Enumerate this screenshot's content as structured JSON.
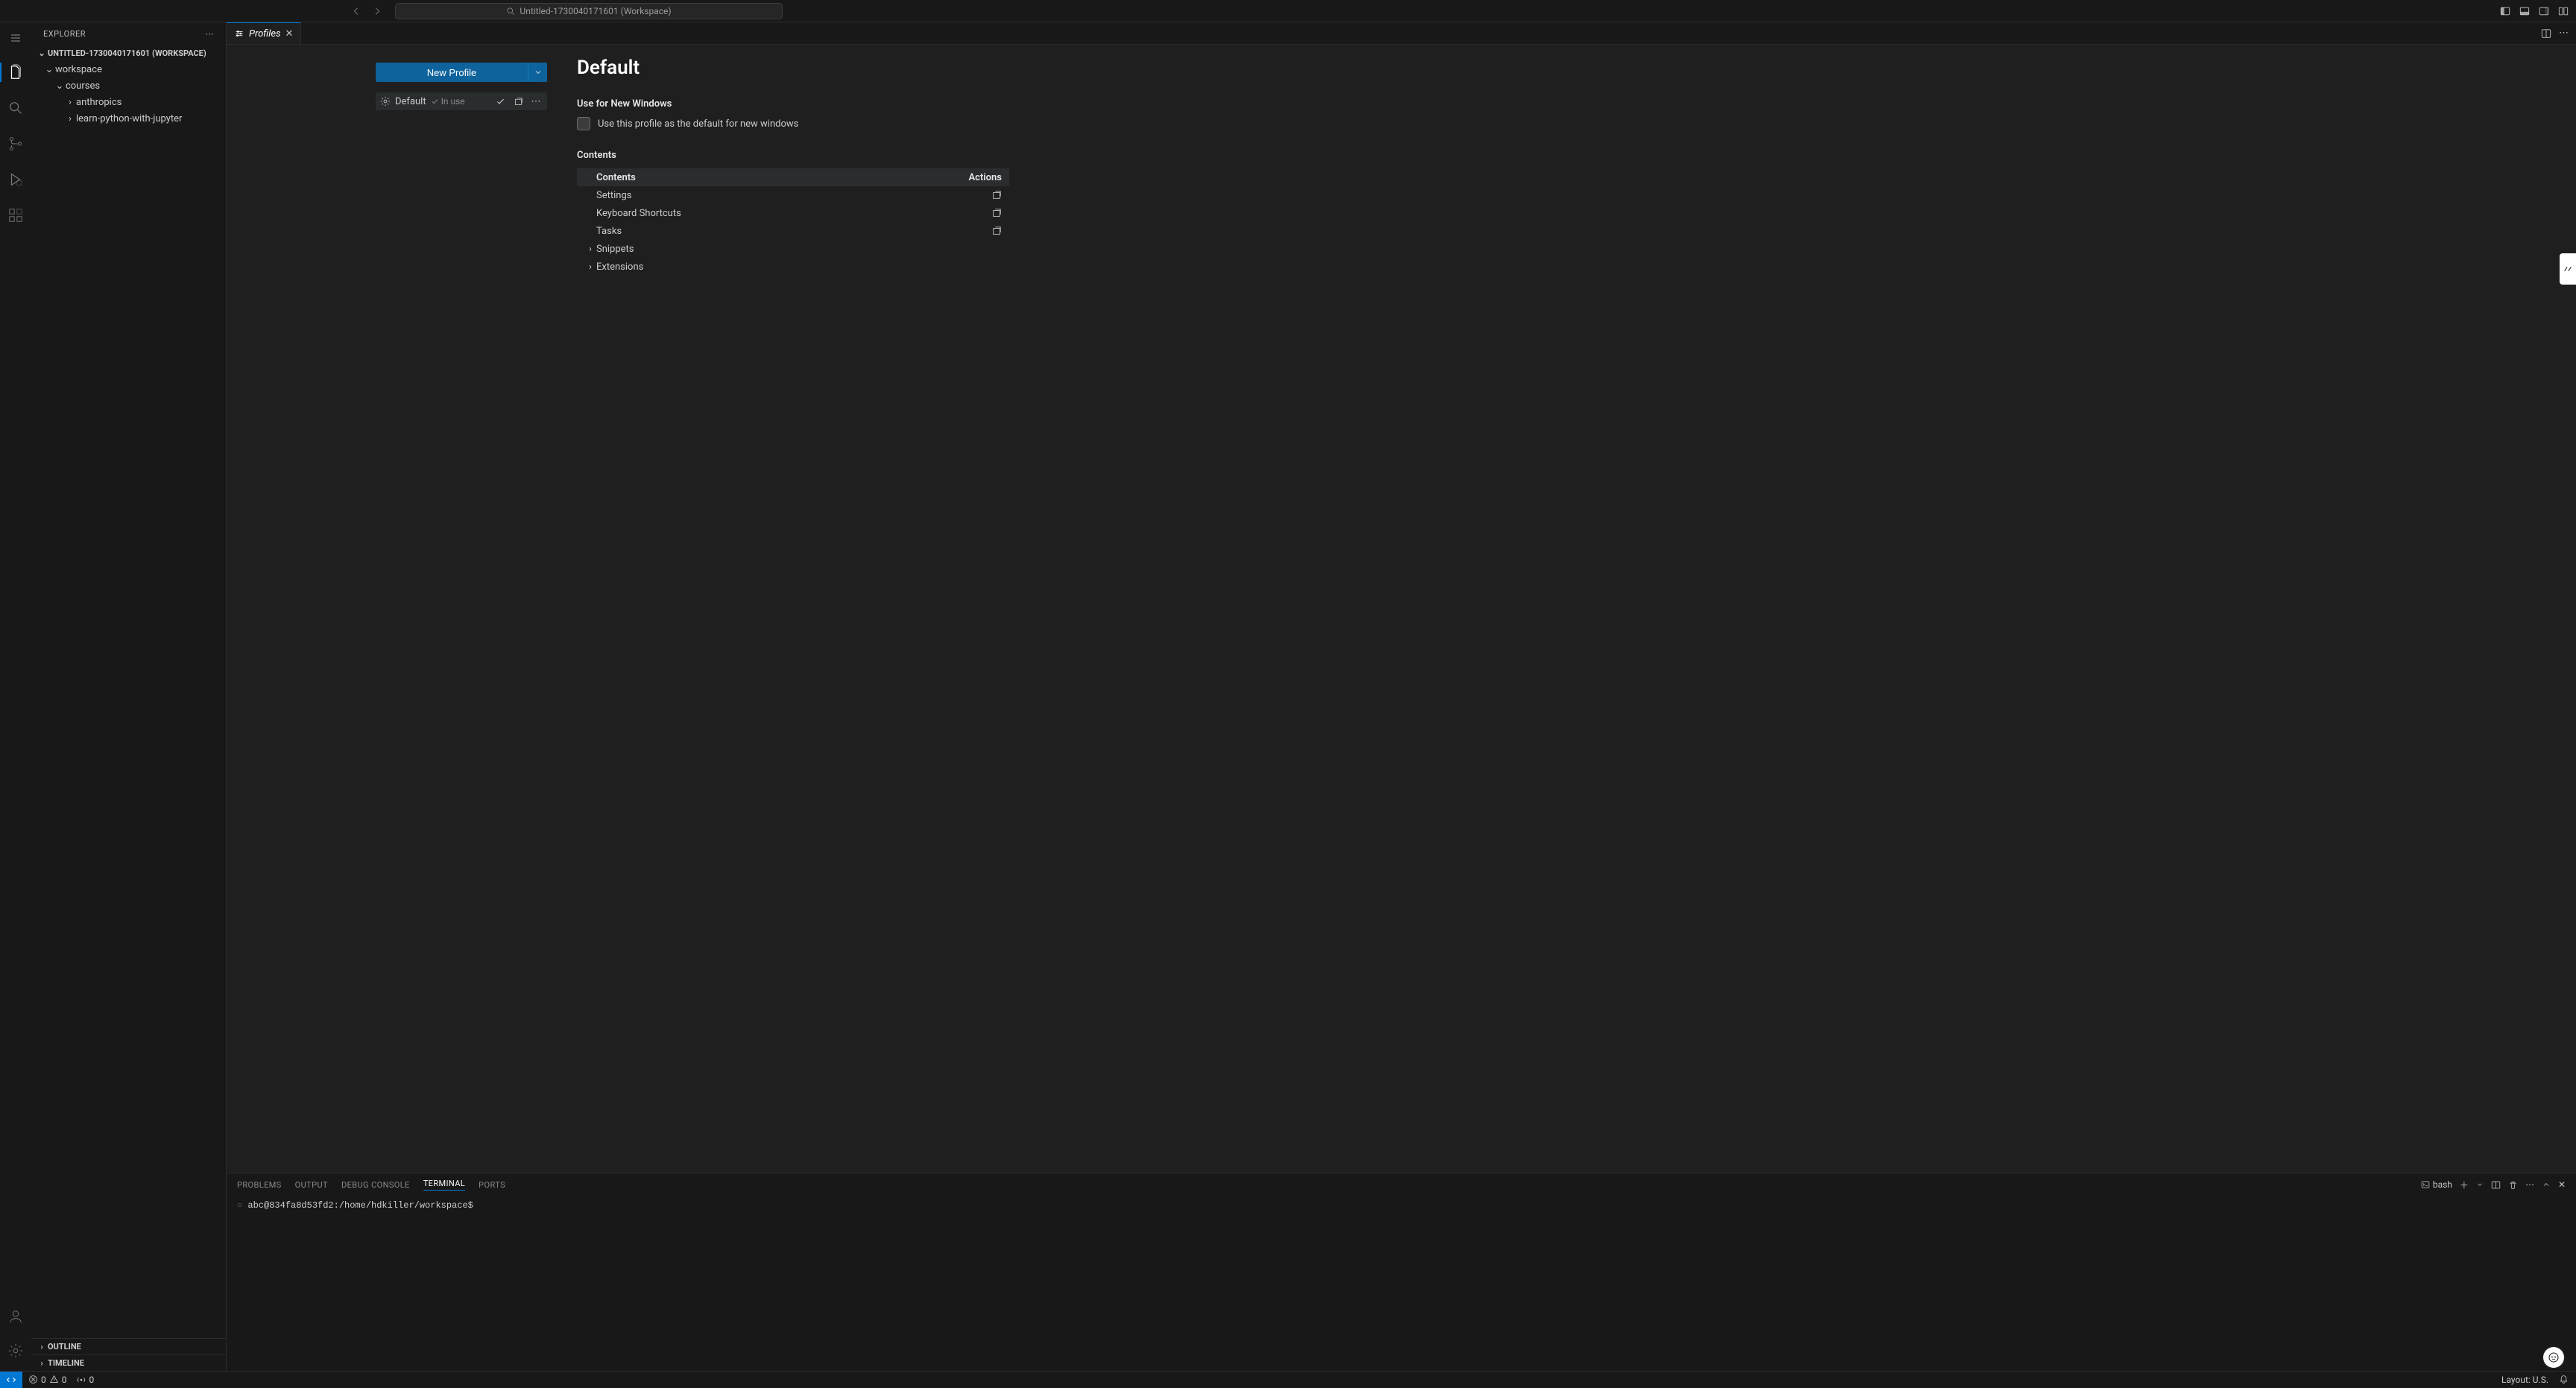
{
  "title_bar": {
    "workspace_label": "Untitled-1730040171601 (Workspace)"
  },
  "sidebar": {
    "title": "EXPLORER",
    "root": "UNTITLED-1730040171601 (WORKSPACE)",
    "tree": {
      "workspace": "workspace",
      "courses": "courses",
      "anthropics": "anthropics",
      "learn_python": "learn-python-with-jupyter"
    },
    "outline": "OUTLINE",
    "timeline": "TIMELINE"
  },
  "tab": {
    "label": "Profiles"
  },
  "profiles": {
    "new_button": "New Profile",
    "list": {
      "default_name": "Default",
      "in_use": "In use"
    },
    "right": {
      "heading": "Default",
      "use_for_new_windows": "Use for New Windows",
      "use_checkbox_label": "Use this profile as the default for new windows",
      "contents_title": "Contents",
      "contents_header_1": "Contents",
      "contents_header_2": "Actions",
      "rows": {
        "settings": "Settings",
        "keyboard": "Keyboard Shortcuts",
        "tasks": "Tasks",
        "snippets": "Snippets",
        "extensions": "Extensions"
      }
    }
  },
  "panel": {
    "tabs": {
      "problems": "PROBLEMS",
      "output": "OUTPUT",
      "debug": "DEBUG CONSOLE",
      "terminal": "TERMINAL",
      "ports": "PORTS"
    },
    "shell_name": "bash",
    "prompt": "abc@834fa8d53fd2:/home/hdkiller/workspace$"
  },
  "status": {
    "errors": "0",
    "warnings": "0",
    "ports": "0",
    "layout": "Layout: U.S."
  }
}
